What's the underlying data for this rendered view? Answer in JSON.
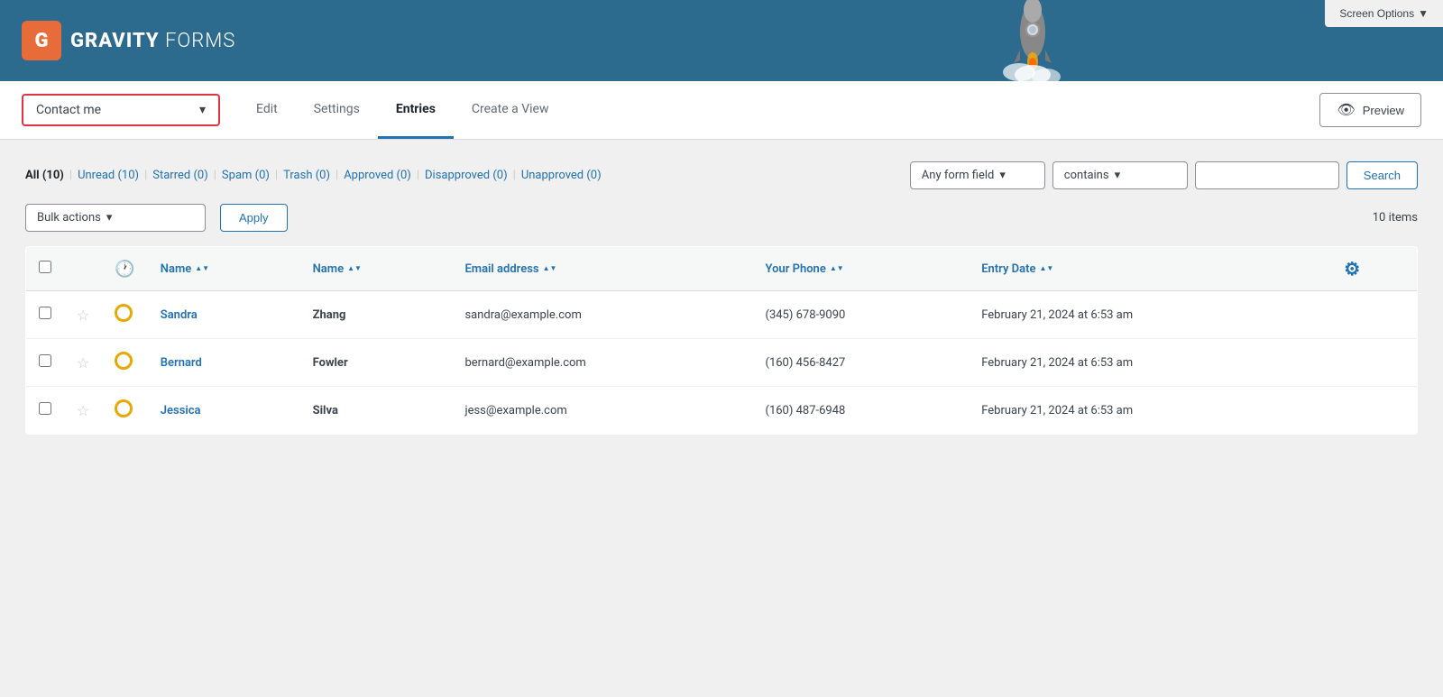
{
  "header": {
    "logo_letter": "G",
    "logo_brand": "GRAVITY",
    "logo_sub": " FORMS",
    "screen_options": "Screen Options"
  },
  "nav": {
    "form_selector": "Contact me",
    "tabs": [
      {
        "label": "Edit",
        "active": false
      },
      {
        "label": "Settings",
        "active": false
      },
      {
        "label": "Entries",
        "active": true
      },
      {
        "label": "Create a View",
        "active": false
      }
    ],
    "preview_label": "Preview"
  },
  "filter": {
    "links": [
      {
        "label": "All",
        "count": "10",
        "active": true
      },
      {
        "label": "Unread",
        "count": "10",
        "active": false
      },
      {
        "label": "Starred",
        "count": "0",
        "active": false
      },
      {
        "label": "Spam",
        "count": "0",
        "active": false
      },
      {
        "label": "Trash",
        "count": "0",
        "active": false
      },
      {
        "label": "Approved",
        "count": "0",
        "active": false
      },
      {
        "label": "Disapproved",
        "count": "0",
        "active": false
      },
      {
        "label": "Unapproved",
        "count": "0",
        "active": false
      }
    ],
    "field_selector": "Any form field",
    "condition_selector": "contains",
    "search_placeholder": "",
    "search_btn": "Search"
  },
  "bulk": {
    "selector_label": "Bulk actions",
    "apply_label": "Apply",
    "items_count": "10 items"
  },
  "table": {
    "columns": [
      {
        "label": "",
        "key": "checkbox"
      },
      {
        "label": "",
        "key": "star"
      },
      {
        "label": "",
        "key": "status"
      },
      {
        "label": "Name",
        "key": "first_name",
        "sortable": true
      },
      {
        "label": "Name",
        "key": "last_name",
        "sortable": true
      },
      {
        "label": "Email address",
        "key": "email",
        "sortable": true
      },
      {
        "label": "Your Phone",
        "key": "phone",
        "sortable": true
      },
      {
        "label": "Entry Date",
        "key": "date",
        "sortable": true
      },
      {
        "label": "",
        "key": "actions"
      }
    ],
    "rows": [
      {
        "first_name": "Sandra",
        "last_name": "Zhang",
        "email": "sandra@example.com",
        "phone": "(345) 678-9090",
        "date": "February 21, 2024 at 6:53 am"
      },
      {
        "first_name": "Bernard",
        "last_name": "Fowler",
        "email": "bernard@example.com",
        "phone": "(160) 456-8427",
        "date": "February 21, 2024 at 6:53 am"
      },
      {
        "first_name": "Jessica",
        "last_name": "Silva",
        "email": "jess@example.com",
        "phone": "(160) 487-6948",
        "date": "February 21, 2024 at 6:53 am"
      }
    ]
  }
}
